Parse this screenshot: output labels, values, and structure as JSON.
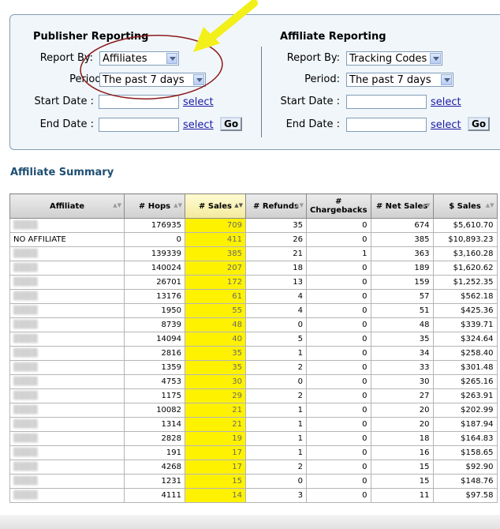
{
  "publisher": {
    "title": "Publisher Reporting",
    "report_by_label": "Report By:",
    "report_by_value": "Affiliates",
    "period_label": "Period:",
    "period_value": "The past 7 days",
    "start_label": "Start Date :",
    "end_label": "End Date :",
    "select_label": "select",
    "go_label": "Go"
  },
  "affiliate": {
    "title": "Affiliate Reporting",
    "report_by_label": "Report By:",
    "report_by_value": "Tracking Codes",
    "period_label": "Period:",
    "period_value": "The past 7 days",
    "start_label": "Start Date :",
    "end_label": "End Date :",
    "select_label": "select",
    "go_label": "Go"
  },
  "summary_title": "Affiliate Summary",
  "table": {
    "headers": [
      "Affiliate",
      "# Hops",
      "# Sales",
      "# Refunds",
      "#\nChargebacks",
      "# Net Sales",
      "$ Sales"
    ],
    "rows": [
      [
        "",
        "176935",
        "709",
        "35",
        "0",
        "674",
        "$5,610.70"
      ],
      [
        "NO AFFILIATE",
        "0",
        "411",
        "26",
        "0",
        "385",
        "$10,893.23"
      ],
      [
        "",
        "139339",
        "385",
        "21",
        "1",
        "363",
        "$3,160.28"
      ],
      [
        "",
        "140024",
        "207",
        "18",
        "0",
        "189",
        "$1,620.62"
      ],
      [
        "",
        "26701",
        "172",
        "13",
        "0",
        "159",
        "$1,252.35"
      ],
      [
        "",
        "13176",
        "61",
        "4",
        "0",
        "57",
        "$562.18"
      ],
      [
        "",
        "1950",
        "55",
        "4",
        "0",
        "51",
        "$425.36"
      ],
      [
        "",
        "8739",
        "48",
        "0",
        "0",
        "48",
        "$339.71"
      ],
      [
        "",
        "14094",
        "40",
        "5",
        "0",
        "35",
        "$324.64"
      ],
      [
        "",
        "2816",
        "35",
        "1",
        "0",
        "34",
        "$258.40"
      ],
      [
        "",
        "1359",
        "35",
        "2",
        "0",
        "33",
        "$301.48"
      ],
      [
        "",
        "4753",
        "30",
        "0",
        "0",
        "30",
        "$265.16"
      ],
      [
        "",
        "1175",
        "29",
        "2",
        "0",
        "27",
        "$263.91"
      ],
      [
        "",
        "10082",
        "21",
        "1",
        "0",
        "20",
        "$202.99"
      ],
      [
        "",
        "1314",
        "21",
        "1",
        "0",
        "20",
        "$187.94"
      ],
      [
        "",
        "2828",
        "19",
        "1",
        "0",
        "18",
        "$164.83"
      ],
      [
        "",
        "191",
        "17",
        "1",
        "0",
        "16",
        "$158.65"
      ],
      [
        "",
        "4268",
        "17",
        "2",
        "0",
        "15",
        "$92.90"
      ],
      [
        "",
        "1231",
        "15",
        "0",
        "0",
        "15",
        "$148.76"
      ],
      [
        "",
        "4111",
        "14",
        "3",
        "0",
        "11",
        "$97.58"
      ]
    ]
  },
  "colors": {
    "panel_bg": "#f1f6fa",
    "panel_border": "#7f9db9",
    "highlight": "#fff200",
    "annotation_circle": "#8b1a1a",
    "link": "#1a1aa6",
    "summary_title": "#1f4f72"
  }
}
